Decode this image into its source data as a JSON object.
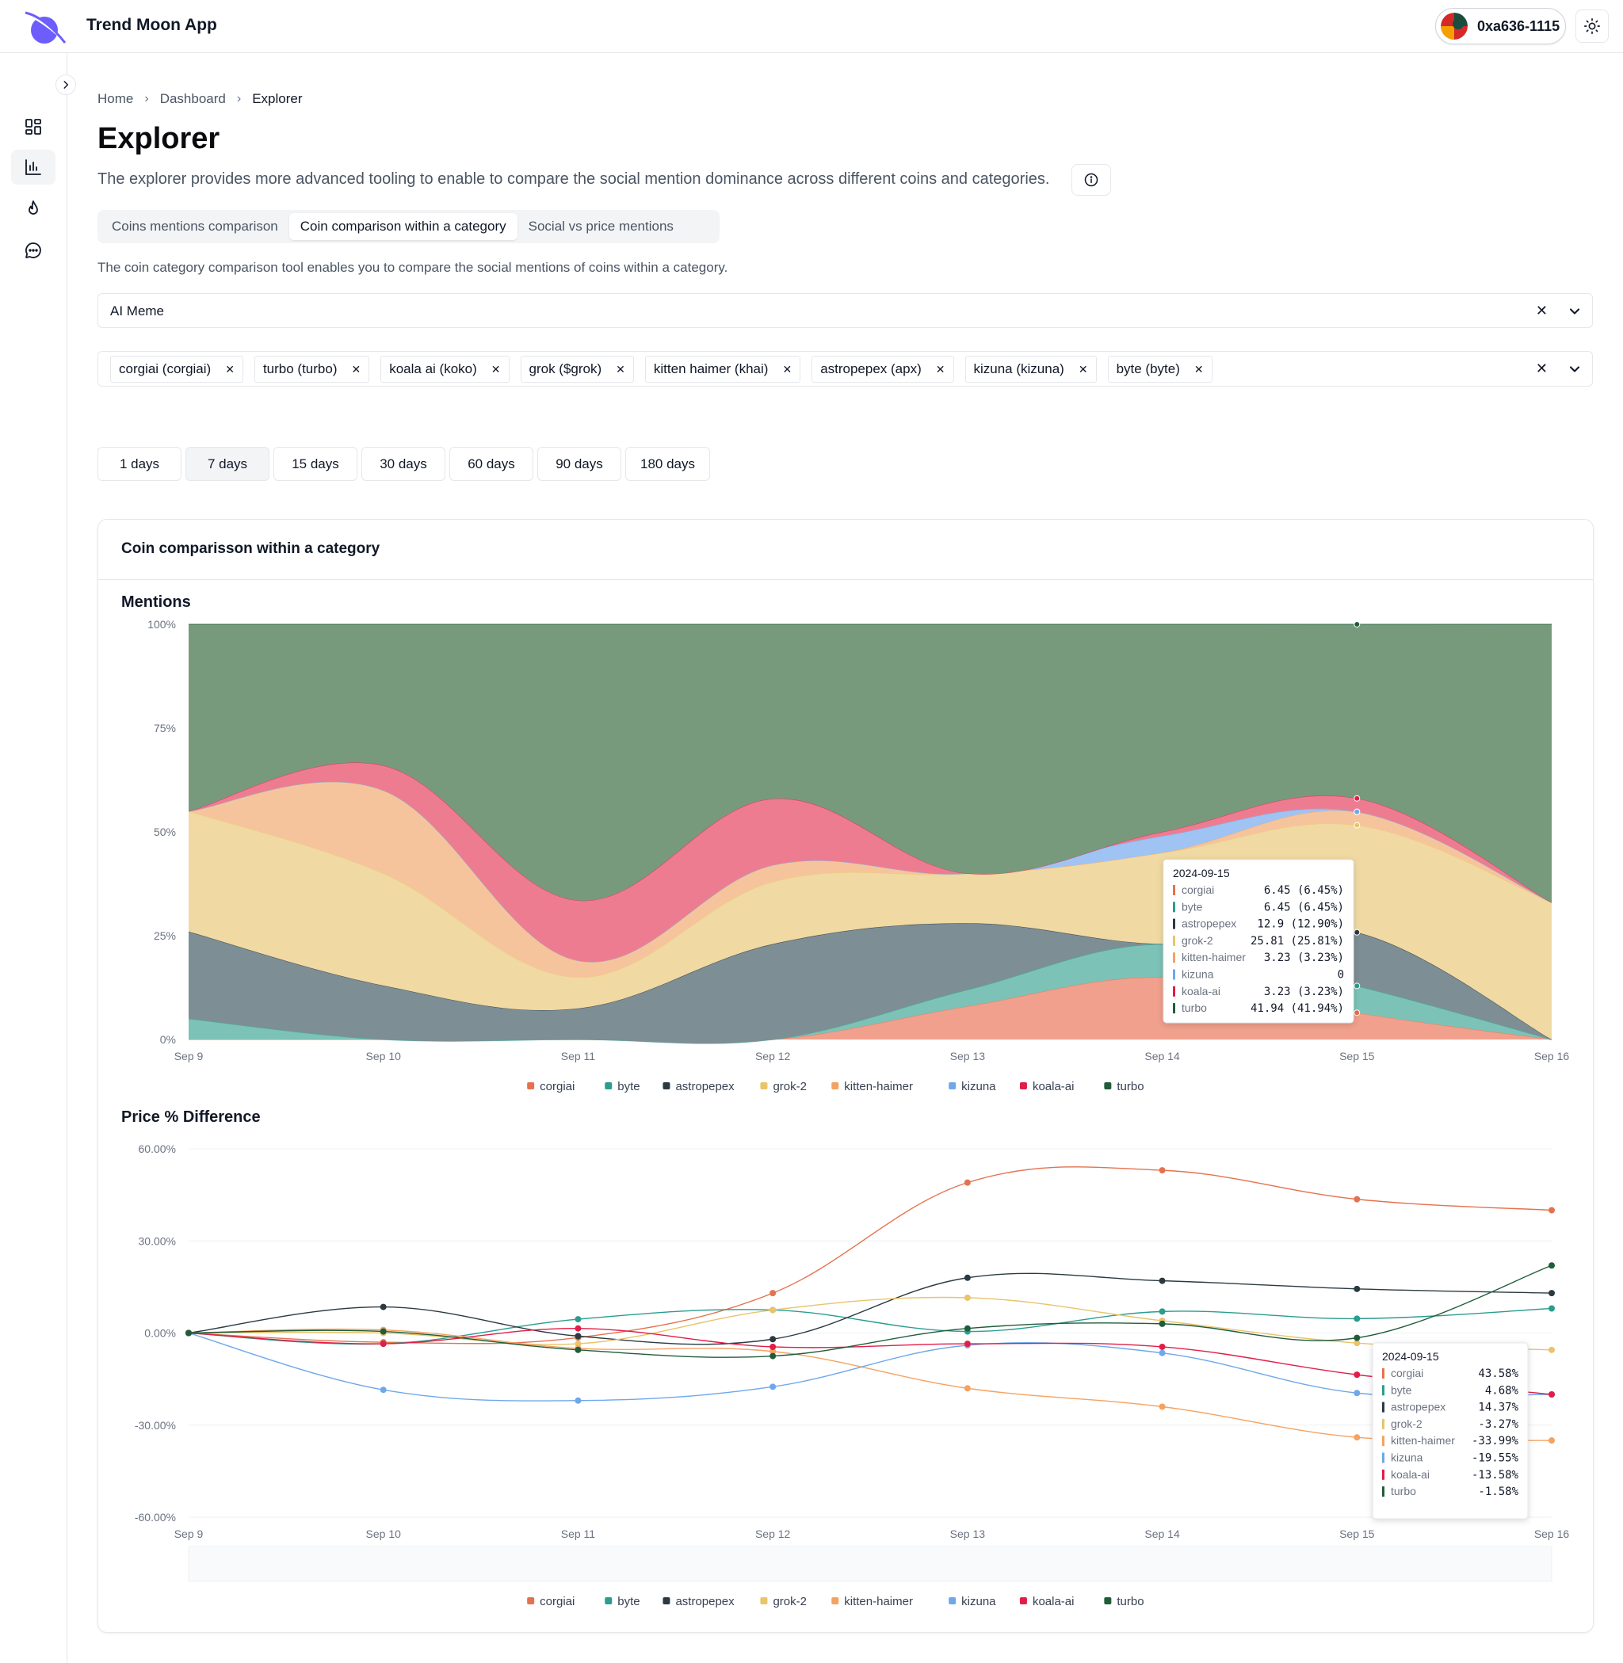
{
  "header": {
    "app_title": "Trend Moon App",
    "wallet_label": "0xa636-1115"
  },
  "sidebar": {
    "items": [
      {
        "icon": "dashboard-grid-icon",
        "active": false
      },
      {
        "icon": "bar-chart-icon",
        "active": true
      },
      {
        "icon": "flame-icon",
        "active": false
      },
      {
        "icon": "chat-bubble-icon",
        "active": false
      }
    ]
  },
  "breadcrumb": [
    "Home",
    "Dashboard",
    "Explorer"
  ],
  "page": {
    "title": "Explorer",
    "description": "The explorer provides more advanced tooling to enable to compare the social mention dominance across different coins and categories.",
    "tool_description": "The coin category comparison tool enables you to compare the social mentions of coins within a category."
  },
  "tabs": [
    {
      "label": "Coins mentions comparison",
      "active": false
    },
    {
      "label": "Coin comparison within a category",
      "active": true
    },
    {
      "label": "Social vs price mentions",
      "active": false
    }
  ],
  "category_select": {
    "value": "AI Meme"
  },
  "coin_chips": [
    "corgiai (corgiai)",
    "turbo (turbo)",
    "koala ai (koko)",
    "grok ($grok)",
    "kitten haimer (khai)",
    "astropepex (apx)",
    "kizuna (kizuna)",
    "byte (byte)"
  ],
  "day_buttons": [
    {
      "label": "1 days",
      "active": false
    },
    {
      "label": "7 days",
      "active": true
    },
    {
      "label": "15 days",
      "active": false
    },
    {
      "label": "30 days",
      "active": false
    },
    {
      "label": "60 days",
      "active": false
    },
    {
      "label": "90 days",
      "active": false
    },
    {
      "label": "180 days",
      "active": false
    }
  ],
  "card": {
    "title": "Coin comparisson within a category",
    "mentions_title": "Mentions",
    "price_title": "Price % Difference"
  },
  "colors": {
    "corgiai": "#e4724f",
    "byte": "#2a9d8f",
    "astropepex": "#2b3a42",
    "grok-2": "#e9c46a",
    "kitten-haimer": "#f4a261",
    "kizuna": "#6ea8ea",
    "koala-ai": "#e11d48",
    "turbo": "#1f5d3a"
  },
  "chart_data": [
    {
      "type": "area",
      "stacked": true,
      "normalized": true,
      "title": "Mentions",
      "x": [
        "Sep 9",
        "Sep 10",
        "Sep 11",
        "Sep 12",
        "Sep 13",
        "Sep 14",
        "Sep 15",
        "Sep 16"
      ],
      "y_ticks": [
        "0%",
        "25%",
        "50%",
        "75%",
        "100%"
      ],
      "ylim": [
        0,
        100
      ],
      "series": [
        {
          "name": "corgiai",
          "values": [
            0,
            0,
            0,
            0,
            8,
            15,
            6.45,
            0
          ]
        },
        {
          "name": "byte",
          "values": [
            5,
            0,
            0,
            0,
            4,
            8,
            6.45,
            0
          ]
        },
        {
          "name": "astropepex",
          "values": [
            21,
            13,
            7.5,
            23,
            16,
            0,
            12.9,
            0
          ]
        },
        {
          "name": "grok-2",
          "values": [
            29,
            27,
            7.5,
            15,
            12,
            22,
            25.81,
            33
          ]
        },
        {
          "name": "kitten-haimer",
          "values": [
            0,
            20,
            4,
            4,
            0,
            0,
            3.23,
            0
          ]
        },
        {
          "name": "kizuna",
          "values": [
            0,
            0,
            0,
            0,
            0,
            4,
            0,
            0
          ]
        },
        {
          "name": "koala-ai",
          "values": [
            0,
            6,
            14.5,
            16,
            0,
            1,
            3.23,
            0
          ]
        },
        {
          "name": "turbo",
          "values": [
            45,
            34,
            66.5,
            42,
            60,
            50,
            41.94,
            67
          ]
        }
      ],
      "legend": [
        "corgiai",
        "byte",
        "astropepex",
        "grok-2",
        "kitten-haimer",
        "kizuna",
        "koala-ai",
        "turbo"
      ],
      "legend_position": "bottom",
      "tooltip": {
        "title": "2024-09-15",
        "rows": [
          {
            "name": "corgiai",
            "value": "6.45 (6.45%)"
          },
          {
            "name": "byte",
            "value": "6.45 (6.45%)"
          },
          {
            "name": "astropepex",
            "value": "12.9 (12.90%)"
          },
          {
            "name": "grok-2",
            "value": "25.81 (25.81%)"
          },
          {
            "name": "kitten-haimer",
            "value": "3.23 (3.23%)"
          },
          {
            "name": "kizuna",
            "value": "0"
          },
          {
            "name": "koala-ai",
            "value": "3.23 (3.23%)"
          },
          {
            "name": "turbo",
            "value": "41.94 (41.94%)"
          }
        ]
      }
    },
    {
      "type": "line",
      "title": "Price % Difference",
      "x": [
        "Sep 9",
        "Sep 10",
        "Sep 11",
        "Sep 12",
        "Sep 13",
        "Sep 14",
        "Sep 15",
        "Sep 16"
      ],
      "y_ticks": [
        "-60.00%",
        "-30.00%",
        "0.00%",
        "30.00%",
        "60.00%"
      ],
      "ylim": [
        -60,
        60
      ],
      "series": [
        {
          "name": "corgiai",
          "values": [
            0,
            -3,
            -1.5,
            13,
            49,
            53,
            43.58,
            40
          ]
        },
        {
          "name": "byte",
          "values": [
            0,
            -3.5,
            4.5,
            7.5,
            0.5,
            7,
            4.68,
            8
          ]
        },
        {
          "name": "astropepex",
          "values": [
            0,
            8.5,
            -1,
            -2,
            18,
            17,
            14.37,
            13
          ]
        },
        {
          "name": "grok-2",
          "values": [
            0,
            0,
            -3.5,
            7.5,
            11.5,
            4,
            -3.27,
            -5.5
          ]
        },
        {
          "name": "kitten-haimer",
          "values": [
            0,
            1,
            -5,
            -6,
            -18,
            -24,
            -33.99,
            -35
          ]
        },
        {
          "name": "kizuna",
          "values": [
            0,
            -18.5,
            -22,
            -17.5,
            -4,
            -6.5,
            -19.55,
            -20
          ]
        },
        {
          "name": "koala-ai",
          "values": [
            0,
            -3.5,
            1.5,
            -4.5,
            -3.5,
            -4.5,
            -13.58,
            -20
          ]
        },
        {
          "name": "turbo",
          "values": [
            0,
            0.5,
            -5.5,
            -7.5,
            1.5,
            3,
            -1.58,
            22
          ]
        }
      ],
      "legend": [
        "corgiai",
        "byte",
        "astropepex",
        "grok-2",
        "kitten-haimer",
        "kizuna",
        "koala-ai",
        "turbo"
      ],
      "legend_position": "bottom",
      "tooltip": {
        "title": "2024-09-15",
        "rows": [
          {
            "name": "corgiai",
            "value": "43.58%"
          },
          {
            "name": "byte",
            "value": "4.68%"
          },
          {
            "name": "astropepex",
            "value": "14.37%"
          },
          {
            "name": "grok-2",
            "value": "-3.27%"
          },
          {
            "name": "kitten-haimer",
            "value": "-33.99%"
          },
          {
            "name": "kizuna",
            "value": "-19.55%"
          },
          {
            "name": "koala-ai",
            "value": "-13.58%"
          },
          {
            "name": "turbo",
            "value": "-1.58%"
          }
        ]
      }
    }
  ]
}
